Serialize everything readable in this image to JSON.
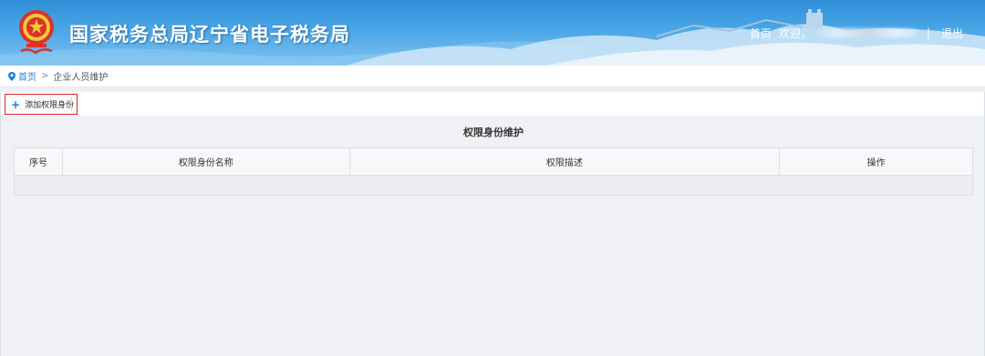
{
  "header": {
    "site_title": "国家税务总局辽宁省电子税务局",
    "nav_home": "首页",
    "nav_welcome": "欢迎，",
    "nav_separator": "|",
    "nav_logout": "退出"
  },
  "breadcrumb": {
    "home": "首页",
    "separator": ">",
    "current": "企业人员维护"
  },
  "toolbar": {
    "add_button_label": "添加权限身份"
  },
  "panel": {
    "title": "权限身份维护"
  },
  "table": {
    "columns": [
      "序号",
      "权限身份名称",
      "权限描述",
      "操作"
    ],
    "rows": []
  },
  "colors": {
    "accent_blue": "#1e7fd4",
    "highlight_red": "#e0202a",
    "panel_bg": "#f0f1f5"
  }
}
